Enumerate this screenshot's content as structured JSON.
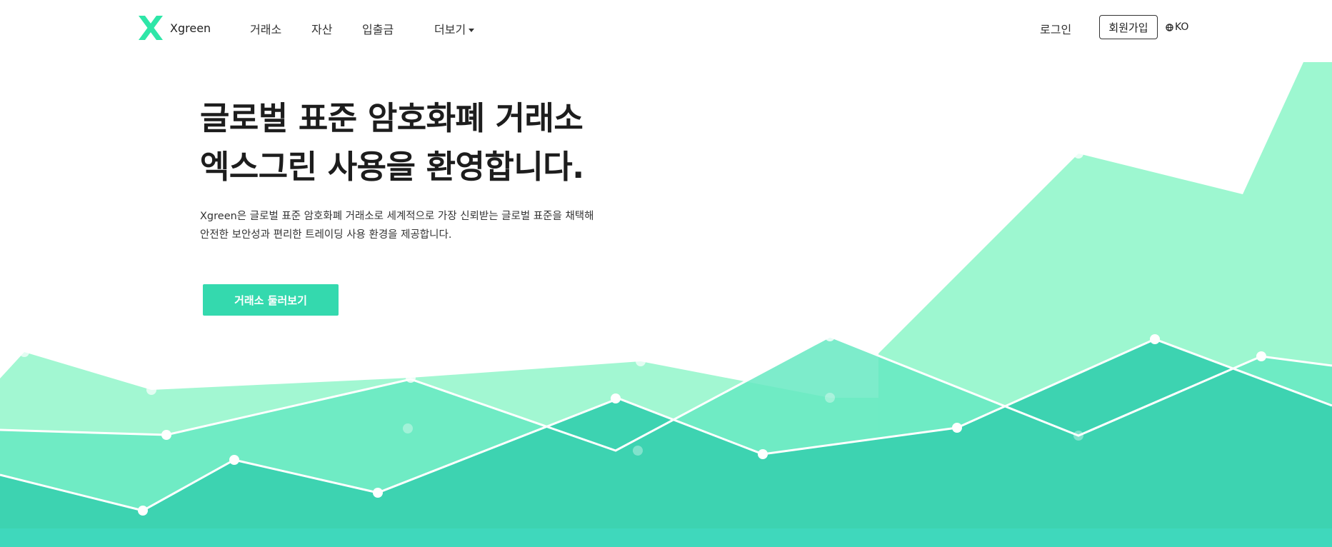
{
  "brand": {
    "name": "Xgreen"
  },
  "nav": {
    "items": [
      {
        "label": "거래소"
      },
      {
        "label": "자산"
      },
      {
        "label": "입출금"
      }
    ],
    "more_label": "더보기",
    "login_label": "로그인",
    "signup_label": "회원가입",
    "language": "KO"
  },
  "hero": {
    "title_line1": "글로벌 표준 암호화폐 거래소",
    "title_line2": "엑스그린 사용을 환영합니다.",
    "desc_line1": "Xgreen은 글로벌 표준 암호화폐 거래소로 세계적으로 가장 신뢰받는 글로벌 표준을 채택해",
    "desc_line2": "안전한 보안성과 편리한 트레이딩 사용 환경을 제공합니다.",
    "cta_label": "거래소 둘러보기"
  },
  "colors": {
    "accent": "#34d9ae",
    "logo": "#2ee6a8",
    "layer_light": "#9df7d0",
    "layer_mid": "#66e9c2",
    "layer_dark": "#3dd3b1",
    "layer_base": "#3fd8bc"
  }
}
